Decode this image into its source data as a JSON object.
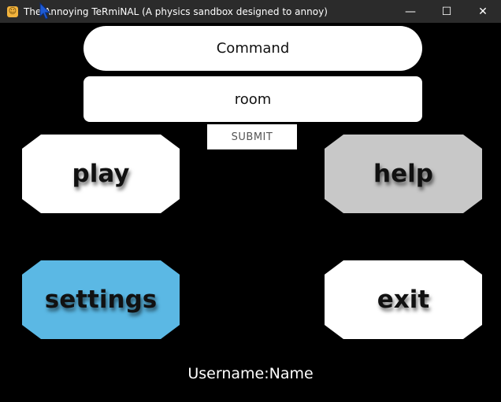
{
  "window": {
    "title": "The Annoying TeRmiNAL (A physics sandbox designed to annoy)",
    "app_icon_glyph": "☺",
    "minimize_glyph": "—",
    "maximize_glyph": "☐",
    "close_glyph": "✕"
  },
  "command": {
    "label": "Command"
  },
  "input": {
    "value": "room"
  },
  "submit": {
    "label": "SUBMIT"
  },
  "menu": {
    "play": {
      "label": "play",
      "color": "#ffffff"
    },
    "help": {
      "label": "help",
      "color": "#c8c8c8"
    },
    "settings": {
      "label": "settings",
      "color": "#5bb8e4"
    },
    "exit": {
      "label": "exit",
      "color": "#ffffff"
    }
  },
  "footer": {
    "username": "Username:Name"
  }
}
